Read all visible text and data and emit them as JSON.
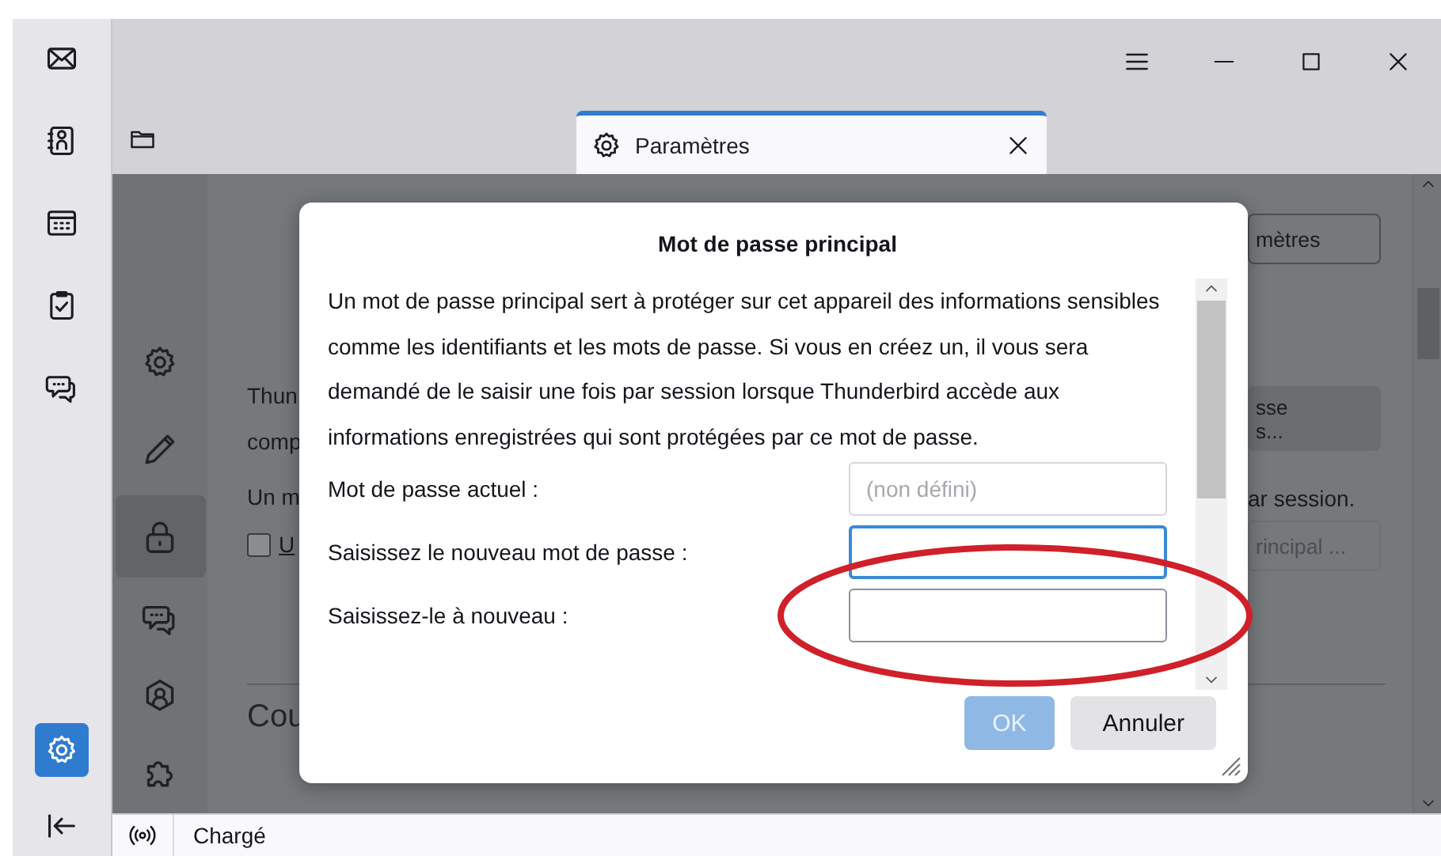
{
  "spaces_toolbar": {
    "items": [
      {
        "kind": "mail",
        "selected": false
      },
      {
        "kind": "address-book",
        "selected": false
      },
      {
        "kind": "calendar",
        "selected": false
      },
      {
        "kind": "tasks",
        "selected": false
      },
      {
        "kind": "chat",
        "selected": false
      }
    ],
    "settings": {
      "selected": true
    }
  },
  "tabs": [
    {
      "kind": "folder",
      "selected": false
    },
    {
      "kind": "settings",
      "label": "Paramètres",
      "selected": true
    }
  ],
  "prefs_nav": [
    {
      "kind": "general",
      "selected": false
    },
    {
      "kind": "compose",
      "selected": false
    },
    {
      "kind": "privacy",
      "selected": true
    },
    {
      "kind": "chat",
      "selected": false
    },
    {
      "kind": "account",
      "selected": false
    },
    {
      "kind": "addons",
      "selected": false
    }
  ],
  "background": {
    "search_button": "mètres",
    "left_texts": [
      "Thun",
      "comp",
      "Un m"
    ],
    "checkbox": {
      "label": "U",
      "checked": false
    },
    "heading": "Cou",
    "right_button": [
      "sse",
      "s..."
    ],
    "right_text": "ar session.",
    "right_button_2": "rincipal ..."
  },
  "dialog": {
    "title": "Mot de passe principal",
    "message": "Un mot de passe principal sert à protéger sur cet appareil des informations sensibles comme les identifiants et les mots de passe. Si vous en créez un, il vous sera demandé de le saisir une fois par session lorsque Thunderbird accède aux informations enregistrées qui sont protégées par ce mot de passe.",
    "fields": [
      {
        "label": "Mot de passe actuel :",
        "placeholder": "(non défini)",
        "disabled": true,
        "focused": false
      },
      {
        "label": "Saisissez le nouveau mot de passe :",
        "disabled": false,
        "focused": true
      },
      {
        "label": "Saisissez-le à nouveau :",
        "disabled": false,
        "focused": false
      }
    ],
    "buttons": [
      {
        "label": "OK",
        "kind": "primary",
        "disabled": true
      },
      {
        "label": "Annuler",
        "kind": "secondary",
        "disabled": false
      }
    ]
  },
  "annotation": {
    "kind": "ellipse"
  },
  "status_bar": {
    "text": "Chargé"
  }
}
